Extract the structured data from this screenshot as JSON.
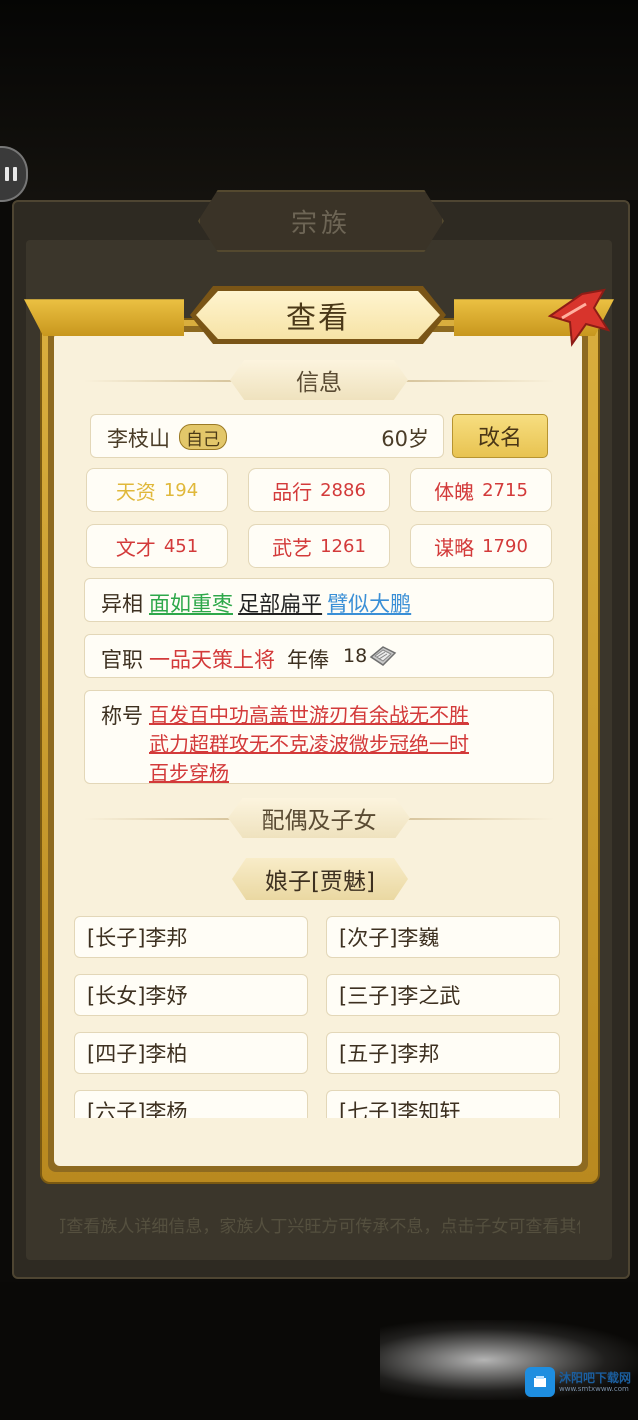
{
  "background_panel": {
    "title": "宗族",
    "hint": "※ 可查看族人详细信息，家族人丁兴旺方可传承不息，点击子女可查看其信息"
  },
  "dialog": {
    "title": "查看",
    "section_info": "信息",
    "name": "李枝山",
    "self_tag": "自己",
    "age": "60岁",
    "rename_button": "改名",
    "stats": [
      {
        "label": "天资",
        "value": "194",
        "color": "#e0b83a"
      },
      {
        "label": "品行",
        "value": "2886",
        "color": "#d33a3a"
      },
      {
        "label": "体魄",
        "value": "2715",
        "color": "#d33a3a"
      },
      {
        "label": "文才",
        "value": "451",
        "color": "#d33a3a"
      },
      {
        "label": "武艺",
        "value": "1261",
        "color": "#d33a3a"
      },
      {
        "label": "谋略",
        "value": "1790",
        "color": "#d33a3a"
      }
    ],
    "appearance": {
      "label": "异相",
      "traits": [
        {
          "text": "面如重枣",
          "color": "#2ea84a"
        },
        {
          "text": "足部扁平",
          "color": "#222222"
        },
        {
          "text": "臂似大鹏",
          "color": "#3a8fd6"
        }
      ]
    },
    "office": {
      "label": "官职",
      "rank": "一品天策上将",
      "salary_label": "年俸",
      "salary_value": "18"
    },
    "honors": {
      "label": "称号",
      "lines": [
        "百发百中功高盖世游刃有余战无不胜",
        "武力超群攻无不克凌波微步冠绝一时",
        "百步穿杨"
      ]
    },
    "section_family": "配偶及子女",
    "consort": "娘子[贾魅]",
    "children": [
      "[长子]李邦",
      "[次子]李巍",
      "[长女]李妤",
      "[三子]李之武",
      "[四子]李柏",
      "[五子]李邦",
      "[六子]李杨",
      "[七子]李知轩"
    ]
  },
  "watermark": {
    "name": "沐阳吧下载网",
    "url": "www.smtxwww.com"
  }
}
